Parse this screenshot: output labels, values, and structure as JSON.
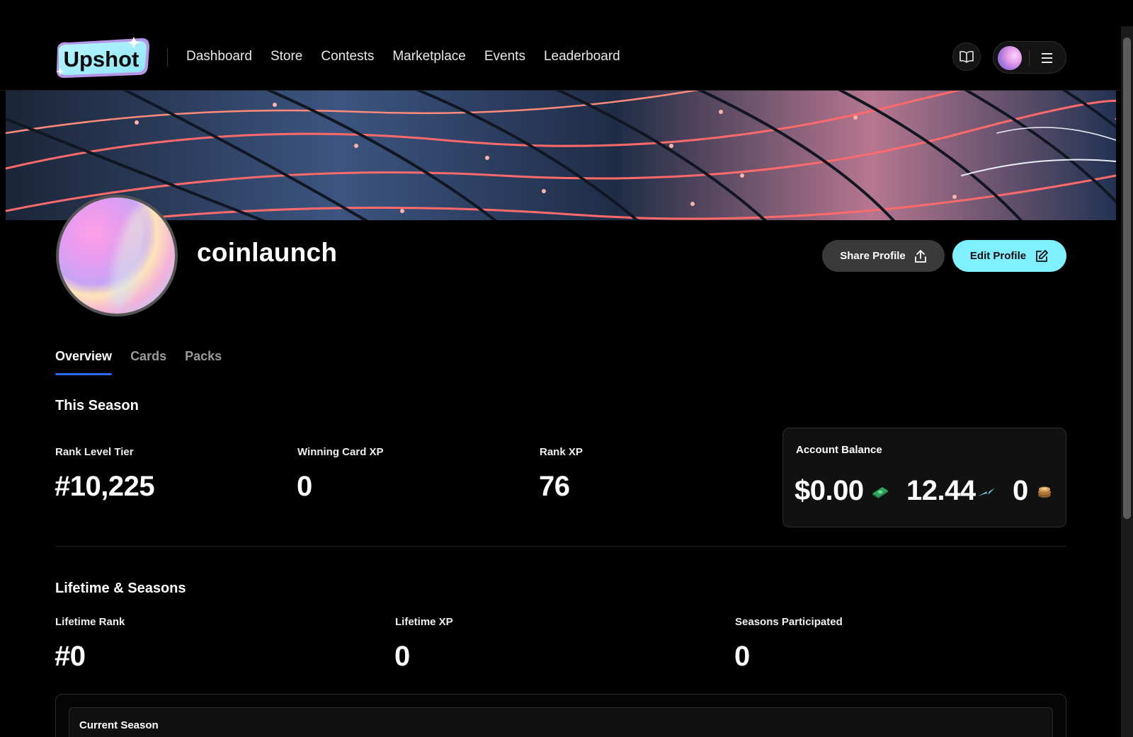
{
  "brand": {
    "logo_text": "Upshot"
  },
  "nav": {
    "items": [
      {
        "label": "Dashboard"
      },
      {
        "label": "Store"
      },
      {
        "label": "Contests"
      },
      {
        "label": "Marketplace"
      },
      {
        "label": "Events"
      },
      {
        "label": "Leaderboard"
      }
    ]
  },
  "header_actions": {
    "book_icon": "book-open-icon",
    "menu_icon": "hamburger-icon"
  },
  "profile": {
    "username": "coinlaunch",
    "share_label": "Share Profile",
    "edit_label": "Edit Profile"
  },
  "tabs": [
    {
      "label": "Overview",
      "active": true
    },
    {
      "label": "Cards",
      "active": false
    },
    {
      "label": "Packs",
      "active": false
    }
  ],
  "this_season": {
    "title": "This Season",
    "stats": [
      {
        "label": "Rank Level Tier",
        "value": "#10,225"
      },
      {
        "label": "Winning Card XP",
        "value": "0"
      },
      {
        "label": "Rank XP",
        "value": "76"
      }
    ],
    "account_balance": {
      "title": "Account Balance",
      "cash": "$0.00",
      "points": "12.44",
      "coins": "0"
    }
  },
  "lifetime": {
    "title": "Lifetime & Seasons",
    "stats": [
      {
        "label": "Lifetime Rank",
        "value": "#0"
      },
      {
        "label": "Lifetime XP",
        "value": "0"
      },
      {
        "label": "Seasons Participated",
        "value": "0"
      }
    ]
  },
  "current_season": {
    "label": "Current Season"
  },
  "colors": {
    "accent_cyan": "#7ff0ff",
    "tab_underline": "#2a6cf0",
    "background": "#000000"
  }
}
